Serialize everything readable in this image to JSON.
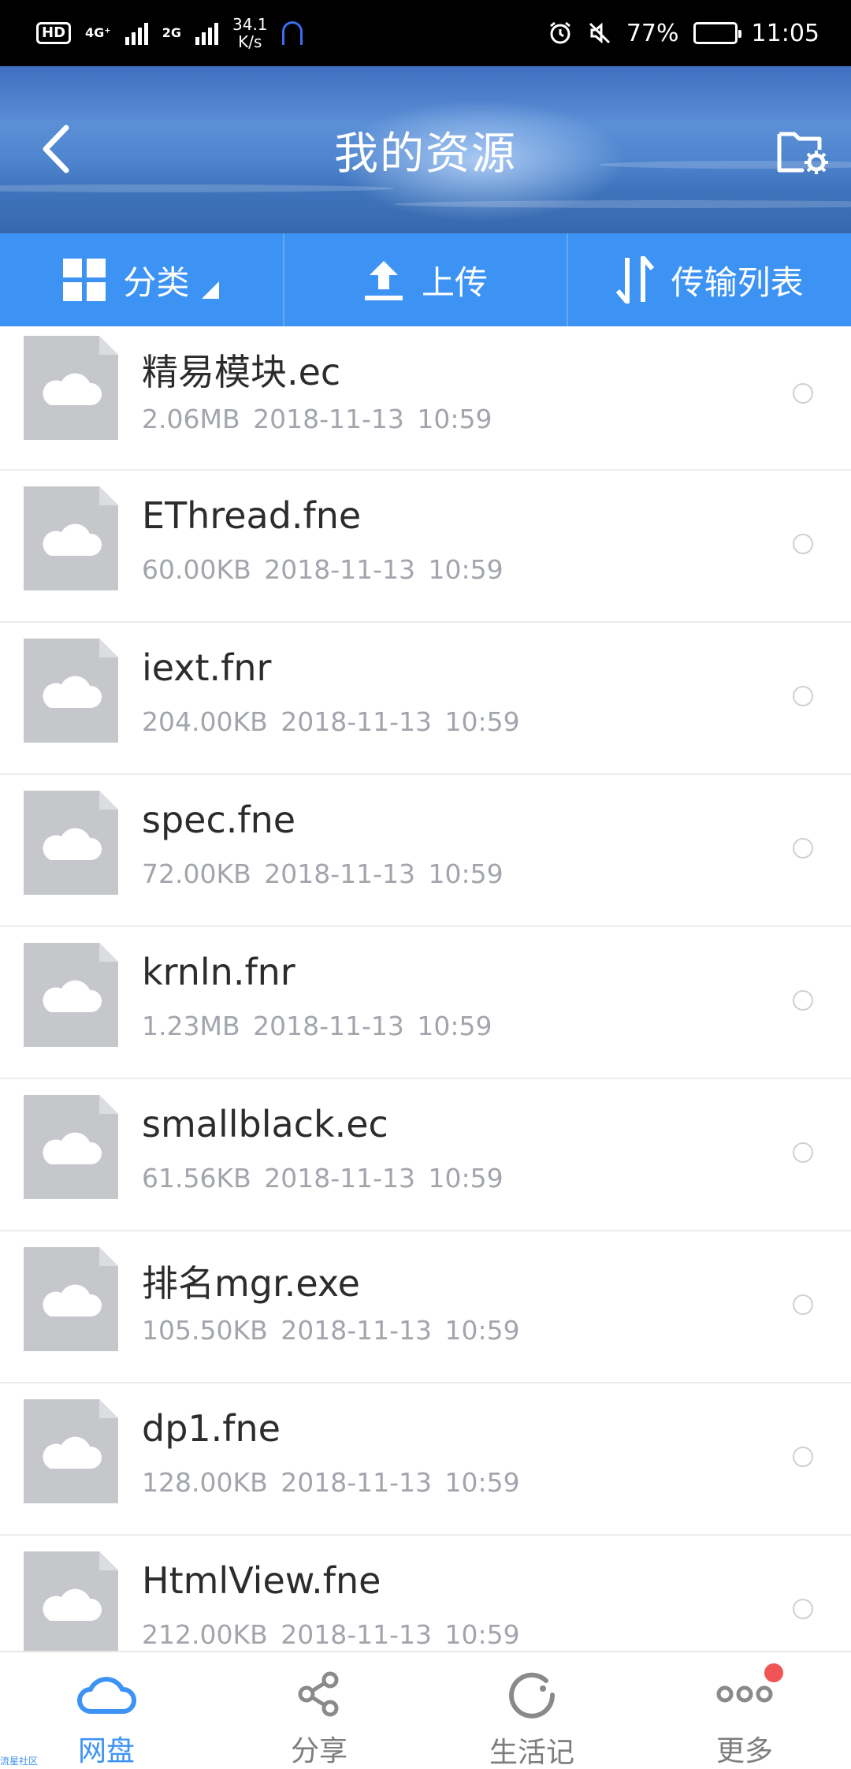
{
  "status_bar": {
    "hd": "HD",
    "net1": "4G⁺",
    "net2": "2G",
    "speed_value": "34.1",
    "speed_unit": "K/s",
    "battery_percent": "77%",
    "time": "11:05",
    "battery_level": 0.77
  },
  "header": {
    "title": "我的资源",
    "back_icon": "chevron-left-icon",
    "folder_icon": "folder-settings-icon"
  },
  "toolbar": {
    "category": "分类",
    "upload": "上传",
    "transfer_list": "传输列表"
  },
  "files": [
    {
      "name": "精易模块.ec",
      "size": "2.06MB",
      "date": "2018-11-13",
      "time": "10:59"
    },
    {
      "name": "EThread.fne",
      "size": "60.00KB",
      "date": "2018-11-13",
      "time": "10:59"
    },
    {
      "name": "iext.fnr",
      "size": "204.00KB",
      "date": "2018-11-13",
      "time": "10:59"
    },
    {
      "name": "spec.fne",
      "size": "72.00KB",
      "date": "2018-11-13",
      "time": "10:59"
    },
    {
      "name": "krnln.fnr",
      "size": "1.23MB",
      "date": "2018-11-13",
      "time": "10:59"
    },
    {
      "name": "smallblack.ec",
      "size": "61.56KB",
      "date": "2018-11-13",
      "time": "10:59"
    },
    {
      "name": "排名mgr.exe",
      "size": "105.50KB",
      "date": "2018-11-13",
      "time": "10:59"
    },
    {
      "name": "dp1.fne",
      "size": "128.00KB",
      "date": "2018-11-13",
      "time": "10:59"
    },
    {
      "name": "HtmlView.fne",
      "size": "212.00KB",
      "date": "2018-11-13",
      "time": "10:59"
    }
  ],
  "bottom_nav": {
    "items": [
      {
        "label": "网盘",
        "icon": "cloud-icon",
        "active": true
      },
      {
        "label": "分享",
        "icon": "share-icon",
        "active": false
      },
      {
        "label": "生活记",
        "icon": "refresh-circle-icon",
        "active": false
      },
      {
        "label": "更多",
        "icon": "more-dots-icon",
        "active": false
      }
    ]
  },
  "watermark": "流星社区",
  "colors": {
    "accent": "#3d93f4",
    "thumb": "#c5c7cb",
    "badge": "#f05454"
  }
}
